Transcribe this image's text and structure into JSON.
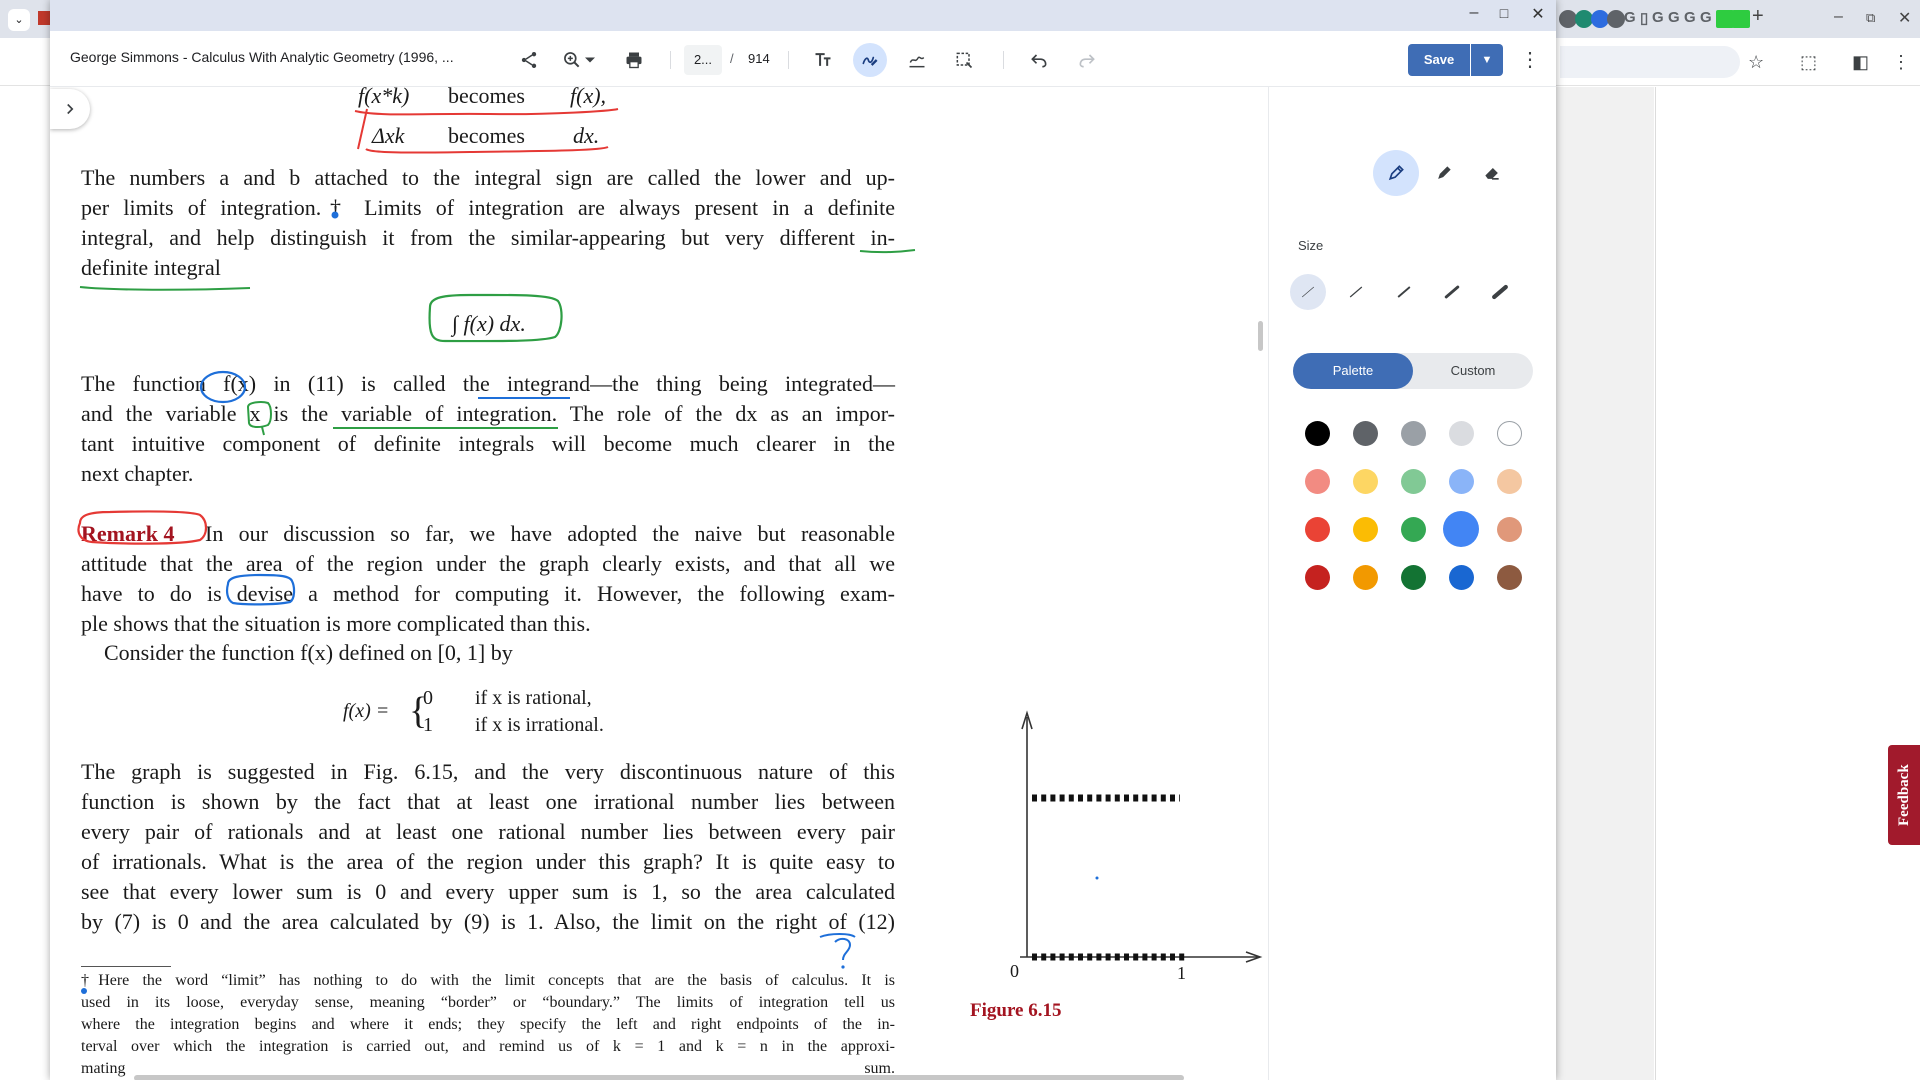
{
  "viewer": {
    "doc_title": "George Simmons - Calculus With Analytic Geometry (1996, ...",
    "page_current": "2...",
    "page_separator": "/",
    "page_total": "914",
    "save_label": "Save"
  },
  "panel": {
    "size_label": "Size",
    "palette_label": "Palette",
    "custom_label": "Custom",
    "swatches": [
      [
        "#000000",
        "#5f6368",
        "#9aa0a6",
        "#dadce0",
        "#ffffff"
      ],
      [
        "#f28b82",
        "#fdd663",
        "#81c995",
        "#8ab4f8",
        "#f4c7a1"
      ],
      [
        "#ea4335",
        "#fbbc04",
        "#34a853",
        "#4285f4",
        "#e0987a"
      ],
      [
        "#c5221f",
        "#f29900",
        "#137333",
        "#1967d2",
        "#8d5a40"
      ]
    ],
    "selected_swatch": "#4285f4"
  },
  "book": {
    "sub_a_left": "f(x*k)",
    "sub_a_mid": "becomes",
    "sub_a_right": "f(x),",
    "sub_b_left": "Δxk",
    "sub_b_mid": "becomes",
    "sub_b_right": "dx.",
    "para1": [
      "The numbers a and b attached to the integral sign are called the lower and up-",
      "per limits of integration.† Limits of integration are always present in a definite",
      "integral, and help distinguish it from the similar-appearing but very different in-",
      "definite integral"
    ],
    "indef_integral": "∫ f(x) dx.",
    "para2": [
      "The function f(x) in (11) is called the integrand—the thing being integrated—",
      "and the variable x is the variable of integration. The role of the dx as an impor-",
      "tant intuitive component of definite integrals will become much clearer in the",
      "next chapter."
    ],
    "remark_label": "Remark 4",
    "para3": [
      "In our discussion so far, we have adopted the naive but reasonable",
      "attitude that the area of the region under the graph clearly exists, and that all we",
      "have to do is devise a method for computing it. However, the following exam-",
      "ple shows that the situation is more complicated than this."
    ],
    "consider": "Consider the function f(x) defined on [0, 1] by",
    "piece_lhs": "f(x) =",
    "piece_v0": "0",
    "piece_c0": "if x is rational,",
    "piece_v1": "1",
    "piece_c1": "if x is irrational.",
    "para4": [
      "The graph is suggested in Fig. 6.15, and the very discontinuous nature of this",
      "function is shown by the fact that at least one irrational number lies between",
      "every pair of rationals and at least one rational number lies between every pair",
      "of irrationals. What is the area of the region under this graph? It is quite easy to",
      "see that every lower sum is 0 and every upper sum is 1, so the area calculated",
      "by (7) is 0 and the area calculated by (9) is 1. Also, the limit on the right of (12)"
    ],
    "footnote": [
      "†Here the word “limit” has nothing to do with the limit concepts that are the basis of calculus. It is",
      "used in its loose, everyday sense, meaning “border” or “boundary.” The limits of integration tell us",
      "where the integration begins and where it ends; they specify the left and right endpoints of the in-",
      "terval over which the integration is carried out, and remind us of k = 1 and k = n in the approxi-",
      "mating sum."
    ],
    "figure_caption": "Figure 6.15",
    "fig_tick_0": "0",
    "fig_tick_1": "1",
    "margin_note": "?"
  },
  "background": {
    "feedback_label": "Feedback"
  },
  "colors": {
    "accent": "#3f6db5",
    "ink_red": "#e53935",
    "ink_green": "#2e9e44",
    "ink_blue": "#1e6fd9",
    "remark_red": "#a31420"
  }
}
